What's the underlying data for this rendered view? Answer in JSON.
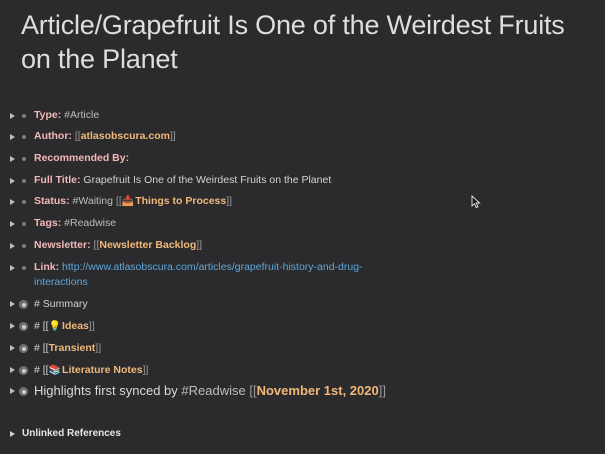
{
  "page": {
    "title": "Article/Grapefruit Is One of the Weirdest Fruits on the Planet"
  },
  "attributes": {
    "type": {
      "label": "Type:",
      "value": "#Article"
    },
    "author": {
      "label": "Author:",
      "open": "[[",
      "page": "atlasobscura.com",
      "close": "]]"
    },
    "recommended_by": {
      "label": "Recommended By:"
    },
    "full_title": {
      "label": "Full Title:",
      "value": "Grapefruit Is One of the Weirdest Fruits on the Planet"
    },
    "status": {
      "label": "Status:",
      "value": "#Waiting",
      "open": "[[",
      "emoji": "📥",
      "page": "Things to Process",
      "close": "]]"
    },
    "tags": {
      "label": "Tags:",
      "value": "#Readwise"
    },
    "newsletter": {
      "label": "Newsletter:",
      "open": "[[",
      "page": "Newsletter Backlog",
      "close": "]]"
    },
    "link": {
      "label": "Link:",
      "url_line1": "http://www.atlasobscura.com/articles/grapefruit-history-and-drug-",
      "url_line2": "interactions"
    }
  },
  "sections": {
    "summary": {
      "text": "# Summary"
    },
    "ideas": {
      "prefix": "# [[",
      "emoji": "💡",
      "page": "Ideas",
      "close": "]]"
    },
    "transient": {
      "prefix": "# [[",
      "page": "Transient",
      "close": "]]"
    },
    "literature": {
      "prefix": "# [[",
      "emoji": "📚",
      "page": "Literature Notes",
      "close": "]]"
    }
  },
  "highlights": {
    "text": "Highlights first synced by",
    "tag": "#Readwise",
    "open": "[[",
    "page": "November 1st, 2020",
    "close": "]]"
  },
  "footer": {
    "unlinked_label": "Unlinked References"
  },
  "icons": {
    "collapse": "caret-right-icon",
    "bullet": "bullet-icon",
    "cursor": "mouse-cursor-icon"
  }
}
